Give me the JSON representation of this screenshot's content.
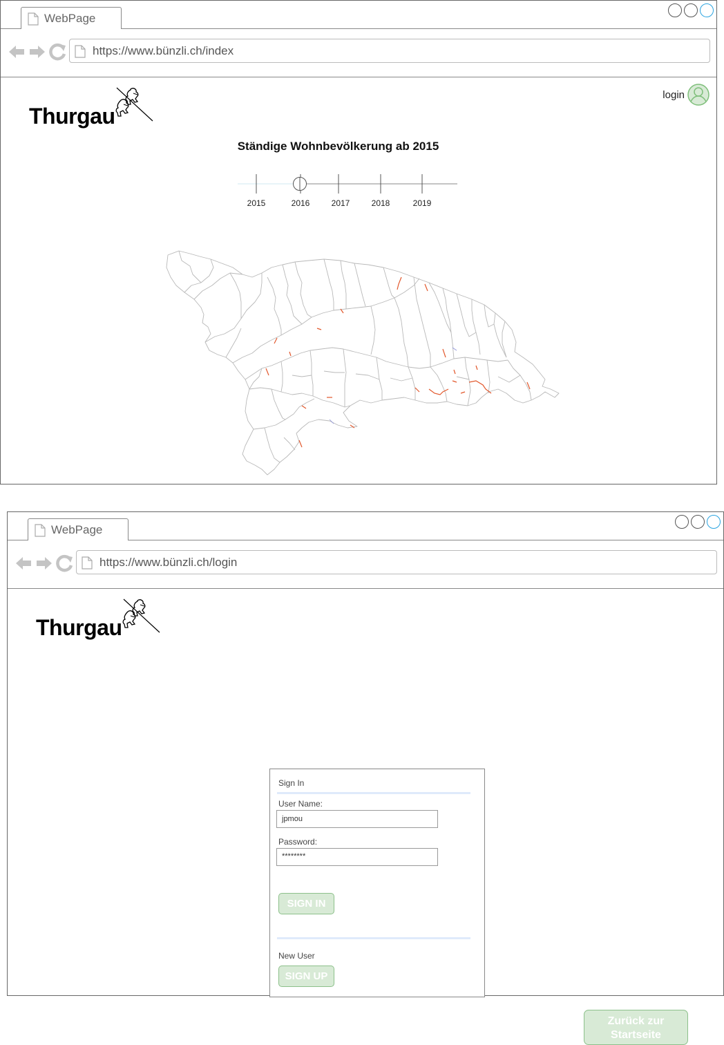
{
  "index_window": {
    "tab_label": "WebPage",
    "url": "https://www.bünzli.ch/index",
    "logo_text": "Thurgau",
    "login_label": "login",
    "page_title": "Ständige Wohnbevölkerung ab 2015",
    "timeline": {
      "years": [
        "2015",
        "2016",
        "2017",
        "2018",
        "2019"
      ],
      "selected_year": "2016"
    },
    "map_icon": "thurgau-municipalities-map"
  },
  "login_window": {
    "tab_label": "WebPage",
    "url": "https://www.bünzli.ch/login",
    "logo_text": "Thurgau",
    "form": {
      "title": "Sign In",
      "username_label": "User Name:",
      "username_value": "jpmou",
      "password_label": "Password:",
      "password_value": "********",
      "sign_in_label": "SIGN IN",
      "new_user_label": "New User",
      "sign_up_label": "SIGN UP"
    },
    "back_button_line1": "Zurück zur",
    "back_button_line2": "Startseite"
  },
  "colors": {
    "button_fill": "#d8ead6",
    "button_border": "#8cc08a",
    "avatar_green": "#7fbf7b",
    "active_window_circle": "#29a3e0",
    "separator": "#dfeafb",
    "map_border_red": "#e2572b"
  },
  "icons": [
    "document-icon",
    "back-arrow-icon",
    "forward-arrow-icon",
    "reload-icon",
    "user-avatar-icon",
    "thurgau-coat-of-arms"
  ]
}
